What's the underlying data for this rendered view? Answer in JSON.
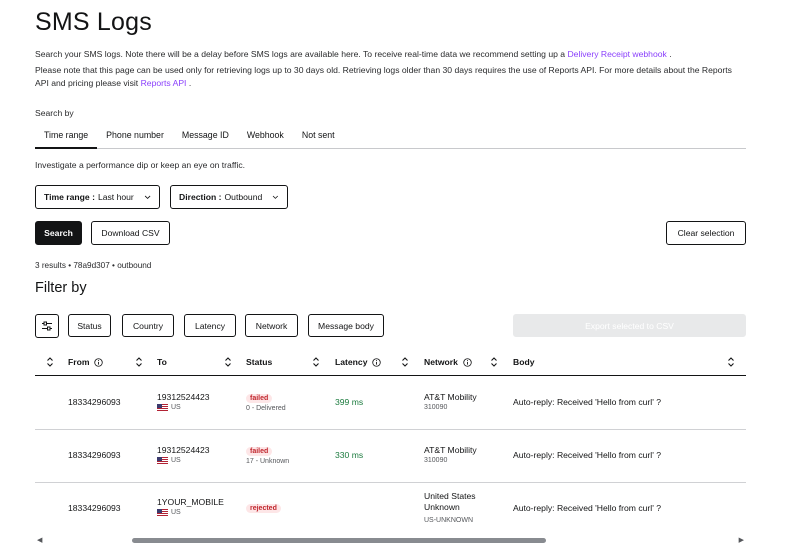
{
  "page": {
    "title": "SMS Logs",
    "intro_line1_prefix": "Search your SMS logs. Note there will be a delay before SMS logs are available here. To receive real-time data we recommend setting up a ",
    "intro_line1_link": "Delivery Receipt webhook",
    "intro_line1_suffix": " .",
    "intro_line2_prefix": "Please note that this page can be used only for retrieving logs up to 30 days old. Retrieving logs older than 30 days requires the use of Reports API. For more details about the Reports API and pricing please visit ",
    "intro_line2_link": "Reports API",
    "intro_line2_suffix": " ."
  },
  "search": {
    "label": "Search by",
    "tabs": [
      "Time range",
      "Phone number",
      "Message ID",
      "Webhook",
      "Not sent"
    ],
    "tab_description": "Investigate a performance dip or keep an eye on traffic.",
    "time_range": {
      "label": "Time range :",
      "value": "Last hour"
    },
    "direction": {
      "label": "Direction :",
      "value": "Outbound"
    },
    "search_button": "Search",
    "download_button": "Download CSV",
    "clear_button": "Clear selection",
    "results_summary": "3 results • 78a9d307 • outbound"
  },
  "filter": {
    "title": "Filter by",
    "chips": [
      "Status",
      "Country",
      "Latency",
      "Network",
      "Message body"
    ],
    "export_button": "Export selected to CSV"
  },
  "table": {
    "columns": [
      "From",
      "To",
      "Status",
      "Latency",
      "Network",
      "Body"
    ],
    "rows": [
      {
        "from": "18334296093",
        "to": "19312524423",
        "to_country": "US",
        "status": "failed",
        "status_detail": "0 - Delivered",
        "latency": "399 ms",
        "network": "AT&T Mobility",
        "network_code": "310090",
        "body": "Auto-reply: Received 'Hello from curl' ?"
      },
      {
        "from": "18334296093",
        "to": "19312524423",
        "to_country": "US",
        "status": "failed",
        "status_detail": "17 - Unknown",
        "latency": "330 ms",
        "network": "AT&T Mobility",
        "network_code": "310090",
        "body": "Auto-reply: Received 'Hello from curl' ?"
      },
      {
        "from": "18334296093",
        "to": "1YOUR_MOBILE",
        "to_country": "US",
        "status": "rejected",
        "status_detail": "",
        "latency": "",
        "network": "United States",
        "network_line2": "Unknown",
        "network_code": "US-UNKNOWN",
        "body": "Auto-reply: Received 'Hello from curl' ?"
      }
    ]
  },
  "colors": {
    "primary": "#131415",
    "link": "#8a3ffc",
    "error_text": "#c0262d",
    "error_bg": "#fde6e7",
    "success": "#1a7a3d"
  },
  "icons": {
    "sort": "sort-icon",
    "info": "info-icon",
    "chevron": "chevron-down-icon",
    "filter": "sliders-icon",
    "flag": "us-flag-icon"
  }
}
